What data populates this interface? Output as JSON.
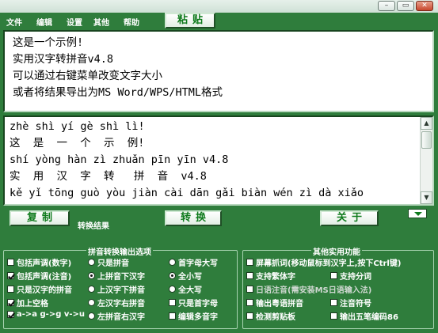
{
  "window_controls": {
    "minimize": "–",
    "restore": "▭",
    "close": "✕"
  },
  "menu": [
    "文件",
    "编辑",
    "设置",
    "其他",
    "帮助"
  ],
  "buttons": {
    "paste": "粘贴",
    "copy": "复制",
    "convert": "转换",
    "about": "关于"
  },
  "input_lines": [
    "这是一个示例!",
    "实用汉字转拼音v4.8",
    "可以通过右键菜单改变文字大小",
    "或者将结果导出为MS Word/WPS/HTML格式"
  ],
  "output_lines": [
    "zhè shì yí gè shì lì!",
    "这  是  一  个  示  例!",
    "shí yòng hàn zì zhuǎn pīn yīn v4.8",
    "实  用  汉  字  转   拼  音  v4.8",
    "kě yǐ tōng guò yòu jiàn cài dān gǎi biàn wén zì dà xiǎo"
  ],
  "conversion_result_label": "转换结果",
  "pinyin_options": {
    "title": "拼音转换输出选项",
    "col1": [
      {
        "label": "包括声调(数字)",
        "checked": false
      },
      {
        "label": "包括声调(注音)",
        "checked": true
      },
      {
        "label": "只是汉字的拼音",
        "checked": false
      },
      {
        "label": "加上空格",
        "checked": true
      },
      {
        "label": "a->a g->g v->u",
        "checked": true
      }
    ],
    "col2": [
      {
        "label": "只是拼音",
        "selected": false
      },
      {
        "label": "上拼音下汉字",
        "selected": true
      },
      {
        "label": "上汉字下拼音",
        "selected": false
      },
      {
        "label": "左汉字右拼音",
        "selected": false
      },
      {
        "label": "左拼音右汉字",
        "selected": false
      }
    ],
    "col3": [
      {
        "label": "首字母大写",
        "kind": "radio",
        "on": false
      },
      {
        "label": "全小写",
        "kind": "radio",
        "on": true
      },
      {
        "label": "全大写",
        "kind": "radio",
        "on": false
      },
      {
        "label": "只是首字母",
        "kind": "check",
        "on": false
      },
      {
        "label": "编辑多音字",
        "kind": "check",
        "on": false
      }
    ]
  },
  "other_functions": {
    "title": "其他实用功能",
    "items": [
      {
        "label": "屏幕抓词(移动鼠标到汉字上,按下Ctrl键)",
        "checked": false,
        "enabled": true
      },
      {
        "label": "支持繁体字",
        "checked": false,
        "enabled": true
      },
      {
        "label": "支持分词",
        "checked": false,
        "enabled": true
      },
      {
        "label": "日语注音(需安装MS日语输入法)",
        "checked": false,
        "enabled": false
      },
      {
        "label": "输出粤语拼音",
        "checked": false,
        "enabled": true
      },
      {
        "label": "注音符号",
        "checked": false,
        "enabled": true
      },
      {
        "label": "检测剪贴板",
        "checked": false,
        "enabled": true
      },
      {
        "label": "输出五笔编码86",
        "checked": false,
        "enabled": true
      }
    ]
  },
  "colors": {
    "background": "#2f7d3c",
    "button_text": "#0e7a1c"
  }
}
